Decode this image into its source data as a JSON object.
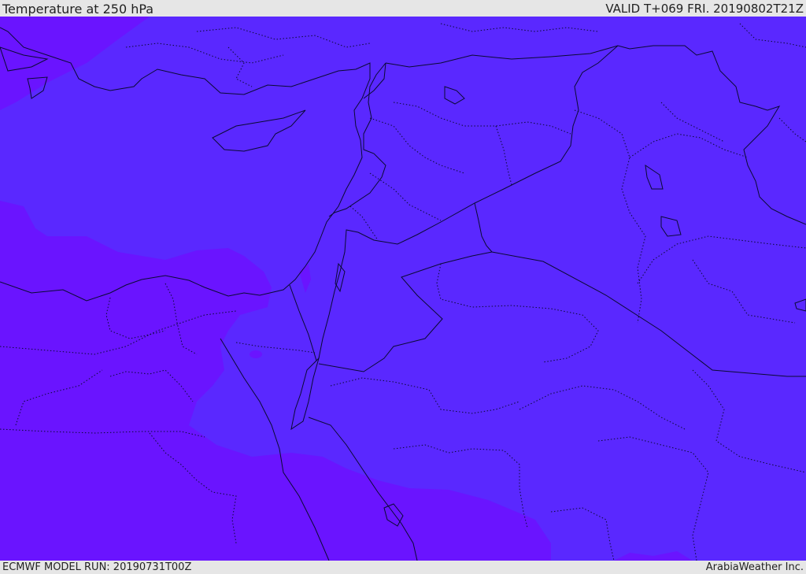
{
  "header": {
    "title": "Temperature at 250 hPa",
    "valid": "VALID T+069 FRI. 20190802T21Z"
  },
  "footer": {
    "model_run": "ECMWF MODEL RUN: 20190731T00Z",
    "credit": "ArabiaWeather Inc."
  },
  "colors": {
    "warm_zone": "#6a14ff",
    "cool_zone": "#5a28ff",
    "lines": "#0a0a33"
  }
}
